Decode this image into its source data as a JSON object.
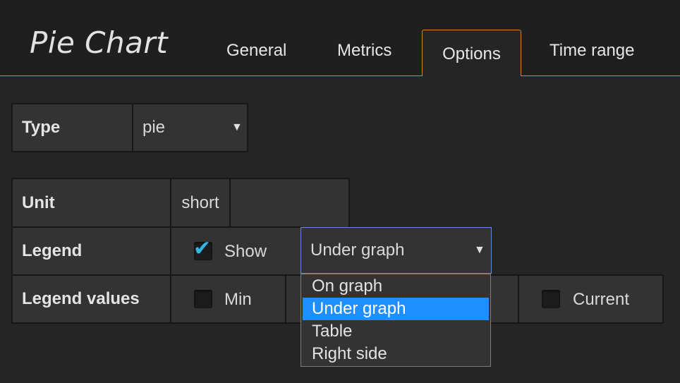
{
  "panel": {
    "title": "Pie Chart"
  },
  "tabs": [
    {
      "label": "General",
      "active": false
    },
    {
      "label": "Metrics",
      "active": false
    },
    {
      "label": "Options",
      "active": true
    },
    {
      "label": "Time range",
      "active": false
    }
  ],
  "type_row": {
    "label": "Type",
    "value": "pie"
  },
  "unit_row": {
    "label": "Unit",
    "value": "short"
  },
  "legend_row": {
    "label": "Legend",
    "show_label": "Show",
    "show_checked": true,
    "position_value": "Under graph"
  },
  "legend_values_row": {
    "label": "Legend values",
    "options": [
      {
        "label": "Min",
        "checked": false
      },
      {
        "label": "Current",
        "checked": false
      }
    ]
  },
  "legend_position_dropdown": {
    "options": [
      "On graph",
      "Under graph",
      "Table",
      "Right side"
    ],
    "selected": "Under graph"
  },
  "colors": {
    "accent": "#c8892f",
    "selected": "#1f8fff",
    "check": "#33b5e5"
  }
}
